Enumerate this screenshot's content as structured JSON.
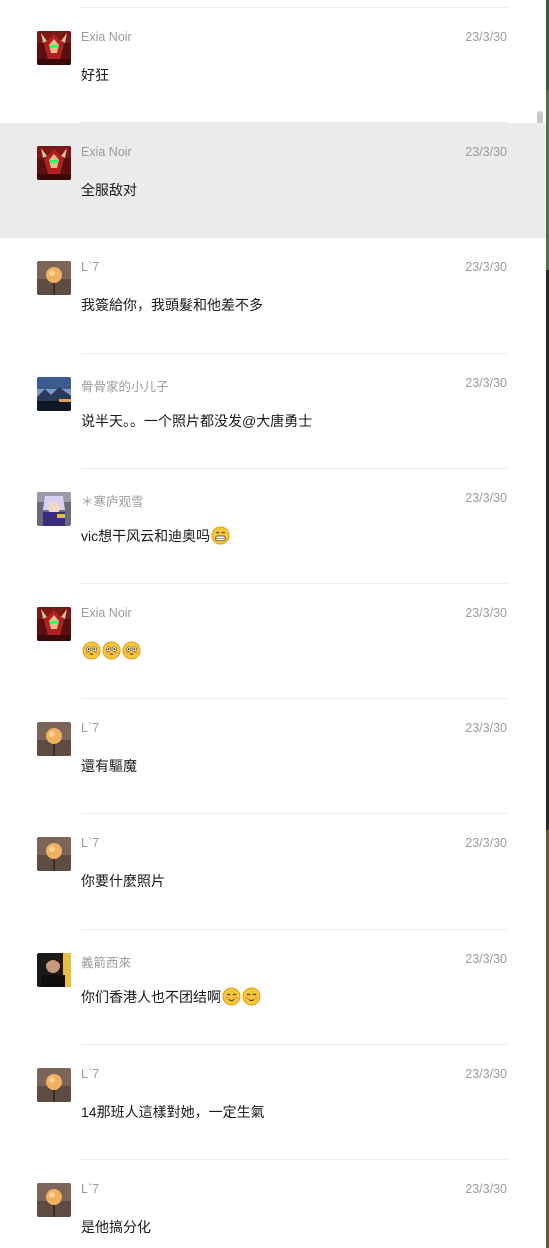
{
  "messages": [
    {
      "name": "Exia Noir",
      "time": "23/3/30",
      "text": "好狂",
      "emojis": [],
      "avatar": "avatar-red-mecha",
      "highlighted": false
    },
    {
      "name": "Exia Noir",
      "time": "23/3/30",
      "text": "全服敌对",
      "emojis": [],
      "avatar": "avatar-red-mecha",
      "highlighted": true
    },
    {
      "name": "L`7",
      "time": "23/3/30",
      "text": "我簽給你，我頭髮和他差不多",
      "emojis": [],
      "avatar": "avatar-moon",
      "highlighted": false
    },
    {
      "name": "骨骨家的小儿子",
      "time": "23/3/30",
      "text": "说半天。。一个照片都没发@大唐勇士",
      "emojis": [],
      "avatar": "avatar-landscape",
      "highlighted": false
    },
    {
      "name": "＊寒庐观雪",
      "time": "23/3/30",
      "text": "vic想干风云和迪奥吗",
      "emojis": [
        "grin-emoji"
      ],
      "avatar": "avatar-anime",
      "highlighted": false
    },
    {
      "name": "Exia Noir",
      "time": "23/3/30",
      "text": "",
      "emojis": [
        "flushed-emoji",
        "flushed-emoji",
        "flushed-emoji"
      ],
      "avatar": "avatar-red-mecha",
      "highlighted": false
    },
    {
      "name": "L`7",
      "time": "23/3/30",
      "text": "還有驅魔",
      "emojis": [],
      "avatar": "avatar-moon",
      "highlighted": false
    },
    {
      "name": "L`7",
      "time": "23/3/30",
      "text": "你要什麼照片",
      "emojis": [],
      "avatar": "avatar-moon",
      "highlighted": false
    },
    {
      "name": "義箭西來",
      "time": "23/3/30",
      "text": "你们香港人也不团结啊",
      "emojis": [
        "blush-emoji",
        "blush-emoji"
      ],
      "avatar": "avatar-person",
      "highlighted": false
    },
    {
      "name": "L`7",
      "time": "23/3/30",
      "text": "14那班人這樣對她，一定生氣",
      "emojis": [],
      "avatar": "avatar-moon",
      "highlighted": false
    },
    {
      "name": "L`7",
      "time": "23/3/30",
      "text": "是他搞分化",
      "emojis": [],
      "avatar": "avatar-moon",
      "highlighted": false
    }
  ]
}
